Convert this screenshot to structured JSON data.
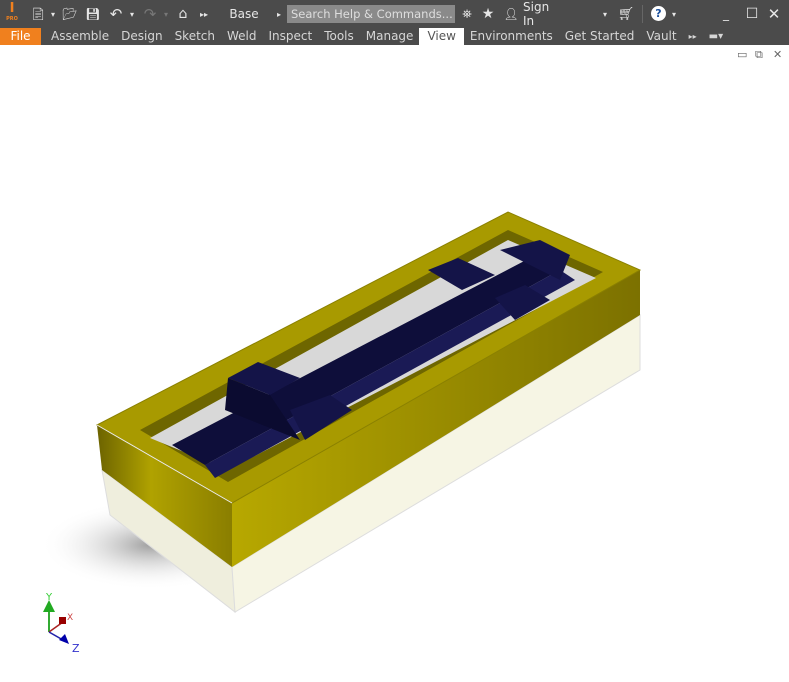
{
  "app": {
    "logo_text": "PRO",
    "environment": "Base",
    "sign_in": "Sign In"
  },
  "search": {
    "placeholder": "Search Help & Commands..."
  },
  "icons": {
    "logo": "inventor-logo-icon",
    "new": "new-file-icon",
    "open": "open-folder-icon",
    "save": "save-icon",
    "undo": "undo-icon",
    "redo": "redo-icon",
    "home": "home-icon",
    "more": "double-chevron-right-icon",
    "comm": "communication-center-icon",
    "favorites": "star-icon",
    "user": "user-icon",
    "cart": "cart-icon",
    "help": "help-icon"
  },
  "tabs": [
    {
      "label": "File"
    },
    {
      "label": "Assemble"
    },
    {
      "label": "Design"
    },
    {
      "label": "Sketch"
    },
    {
      "label": "Weld"
    },
    {
      "label": "Inspect"
    },
    {
      "label": "Tools"
    },
    {
      "label": "Manage"
    },
    {
      "label": "View",
      "active": true
    },
    {
      "label": "Environments"
    },
    {
      "label": "Get Started"
    },
    {
      "label": "Vault"
    }
  ],
  "colors": {
    "file_tab": "#f0801e",
    "chrome": "#4b4b4b",
    "frame": "#a89a00",
    "bars": "#0e0e3a"
  },
  "triad": {
    "x": "X",
    "y": "Y",
    "z": "Z"
  }
}
